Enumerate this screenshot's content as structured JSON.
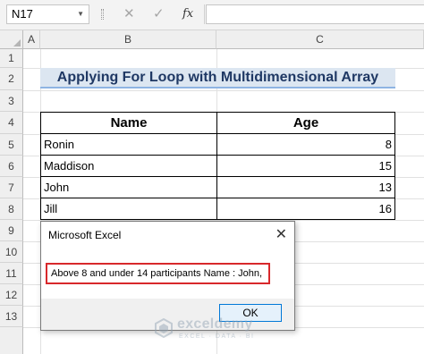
{
  "formula_bar": {
    "name_box": "N17",
    "cancel_icon": "cancel-icon",
    "enter_icon": "check-icon",
    "fx_label": "fx",
    "formula": ""
  },
  "columns": [
    "A",
    "B",
    "C"
  ],
  "rows": [
    "1",
    "2",
    "3",
    "4",
    "5",
    "6",
    "7",
    "8",
    "9",
    "10",
    "11",
    "12",
    "13"
  ],
  "sheet": {
    "title": "Applying For Loop with Multidimensional Array",
    "table": {
      "headers": [
        "Name",
        "Age"
      ],
      "rows": [
        {
          "name": "Ronin",
          "age": "8"
        },
        {
          "name": "Maddison",
          "age": "15"
        },
        {
          "name": "John",
          "age": "13"
        },
        {
          "name": "Jill",
          "age": "16"
        }
      ]
    }
  },
  "dialog": {
    "title": "Microsoft Excel",
    "message": "Above 8 and under 14 participants Name : John,",
    "ok_label": "OK",
    "close_icon": "close-icon"
  },
  "watermark": {
    "name": "exceldemy",
    "tagline": "EXCEL · DATA · BI"
  },
  "colors": {
    "title_fill": "#dce6f1",
    "title_text": "#1f3864",
    "highlight_border": "#d8282b",
    "ok_border": "#0078d7"
  }
}
